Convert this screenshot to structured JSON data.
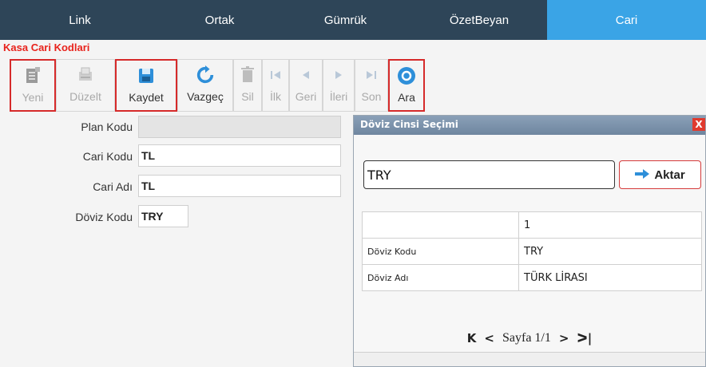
{
  "nav": {
    "tabs": [
      {
        "label": "Link"
      },
      {
        "label": "Ortak"
      },
      {
        "label": "Gümrük"
      },
      {
        "label": "ÖzetBeyan"
      },
      {
        "label": "Cari"
      }
    ],
    "active_tab": "Cari",
    "colors": {
      "bar": "#2e4558",
      "active": "#3aa4e6"
    }
  },
  "section_title": "Kasa Cari Kodlari",
  "toolbar": {
    "new": "Yeni",
    "edit": "Düzelt",
    "save": "Kaydet",
    "cancel": "Vazgeç",
    "delete": "Sil",
    "first": "İlk",
    "prev": "Geri",
    "next": "İleri",
    "last": "Son",
    "search": "Ara"
  },
  "form": {
    "plan_kodu": {
      "label": "Plan Kodu",
      "value": ""
    },
    "cari_kodu": {
      "label": "Cari Kodu",
      "value": "TL"
    },
    "cari_adi": {
      "label": "Cari Adı",
      "value": "TL"
    },
    "doviz_kodu": {
      "label": "Döviz Kodu",
      "value": "TRY"
    }
  },
  "dialog": {
    "title": "Döviz Cinsi Seçimi",
    "close": "X",
    "search_value": "TRY",
    "aktar_label": "Aktar",
    "header_col": "1",
    "rows": [
      {
        "key": "Döviz Kodu",
        "value": "TRY"
      },
      {
        "key": "Döviz Adı",
        "value": "TÜRK LİRASI"
      }
    ],
    "pager": {
      "first": "K",
      "prev": "<",
      "text": "Sayfa 1/1",
      "next": ">",
      "last": "ᐳ|"
    }
  }
}
